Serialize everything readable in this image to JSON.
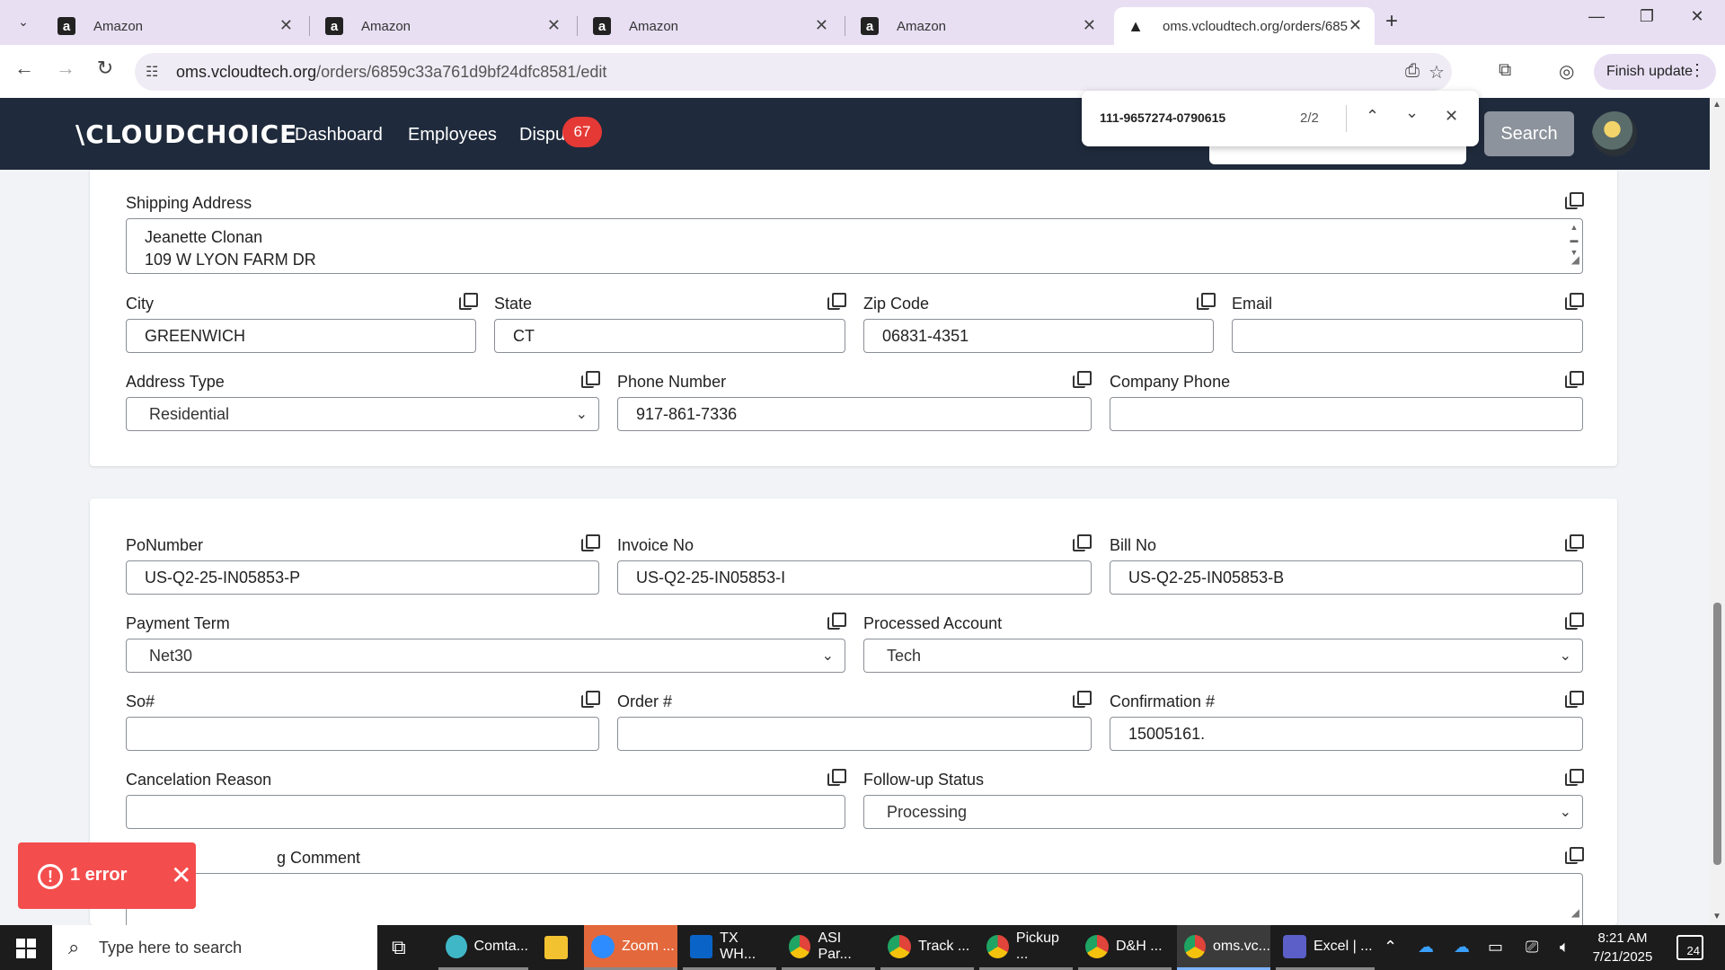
{
  "browser": {
    "tabs": [
      {
        "title": "Amazon",
        "favicon": "a"
      },
      {
        "title": "Amazon",
        "favicon": "a"
      },
      {
        "title": "Amazon",
        "favicon": "a"
      },
      {
        "title": "Amazon",
        "favicon": "a"
      },
      {
        "title": "oms.vcloudtech.org/orders/685",
        "favicon": "▲"
      }
    ],
    "url_host": "oms.vcloudtech.org",
    "url_path": "/orders/6859c33a761d9bf24dfc8581/edit",
    "finish_update_label": "Finish update"
  },
  "find_bar": {
    "query": "111-9657274-0790615",
    "count": "2/2"
  },
  "header": {
    "logo": "\\CLOUDCHOICE",
    "nav": [
      "Dashboard",
      "Employees",
      "Dispu"
    ],
    "badge_count": "67",
    "search_button": "Search"
  },
  "shipping": {
    "address_label": "Shipping Address",
    "address_line1": "Jeanette Clonan",
    "address_line2": "109 W LYON FARM DR",
    "city_label": "City",
    "city": "GREENWICH",
    "state_label": "State",
    "state": "CT",
    "zip_label": "Zip Code",
    "zip": "06831-4351",
    "email_label": "Email",
    "email": "",
    "address_type_label": "Address Type",
    "address_type": "Residential",
    "phone_label": "Phone Number",
    "phone": "917-861-7336",
    "company_phone_label": "Company Phone",
    "company_phone": ""
  },
  "order": {
    "po_label": "PoNumber",
    "po": "US-Q2-25-IN05853-P",
    "invoice_label": "Invoice No",
    "invoice": "US-Q2-25-IN05853-I",
    "bill_label": "Bill No",
    "bill": "US-Q2-25-IN05853-B",
    "payment_term_label": "Payment Term",
    "payment_term": "Net30",
    "processed_account_label": "Processed Account",
    "processed_account": "Tech",
    "so_label": "So#",
    "so": "",
    "order_no_label": "Order #",
    "order_no": "",
    "confirmation_label": "Confirmation #",
    "confirmation": "15005161.",
    "cancel_reason_label": "Cancelation Reason",
    "cancel_reason": "",
    "followup_label": "Follow-up Status",
    "followup": "Processing",
    "comment_label": "g Comment"
  },
  "toast": {
    "message": "1 error"
  },
  "taskbar": {
    "search_placeholder": "Type here to search",
    "apps": [
      {
        "label": "Comta...",
        "color": "#3fb7c7"
      },
      {
        "label": "",
        "color": "#f2c230"
      },
      {
        "label": "Zoom ...",
        "color": "#2d8cff"
      },
      {
        "label": "TX WH...",
        "color": "#0a64c8"
      },
      {
        "label": "ASI Par...",
        "color": "#e0443a"
      },
      {
        "label": "Track ...",
        "color": "#e0443a"
      },
      {
        "label": "Pickup ...",
        "color": "#e0443a"
      },
      {
        "label": "D&H ...",
        "color": "#e0443a"
      },
      {
        "label": "oms.vc...",
        "color": "#e0443a"
      },
      {
        "label": "Excel | ...",
        "color": "#5b5fc7"
      }
    ],
    "time": "8:21 AM",
    "date": "7/21/2025",
    "notifications": "24"
  }
}
